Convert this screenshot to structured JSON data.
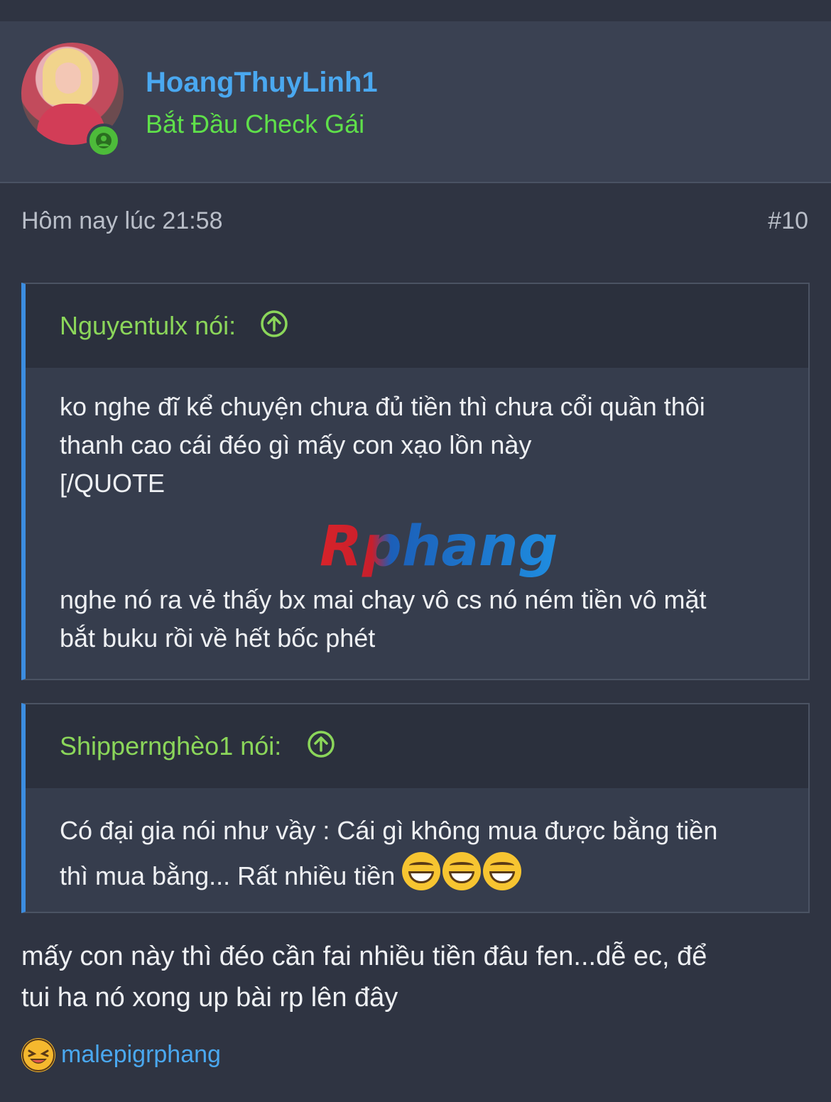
{
  "user": {
    "username": "HoangThuyLinh1",
    "title": "Bắt Đầu Check Gái",
    "avatar_icon": "user-avatar",
    "status_icon": "online-user-icon",
    "status_color": "#4dbb3a"
  },
  "post": {
    "time": "Hôm nay lúc 21:58",
    "number": "#10"
  },
  "quotes": [
    {
      "author": "Nguyentulx nói:",
      "icon": "arrow-up-circle-icon",
      "lines": [
        "ko nghe đĩ kể chuyện chưa đủ tiền thì chưa cổi quần thôi",
        "thanh cao cái đéo gì mấy con xạo lồn này",
        "[/QUOTE"
      ],
      "watermark": "Rphang",
      "lines_after": [
        "nghe nó ra vẻ thấy bx mai chay vô cs nó ném tiền vô mặt",
        "bắt buku rồi về hết bốc phét"
      ]
    },
    {
      "author": "Shippernghèo1 nói:",
      "icon": "arrow-up-circle-icon",
      "lines": [
        "Có đại gia nói như vầy : Cái gì không mua được bằng tiền",
        "thì mua bằng... Rất nhiều tiền"
      ],
      "emoji_icon": "grinning-face-emoji"
    }
  ],
  "reply": {
    "line1": "mấy con này thì đéo cần fai nhiều tiền đâu fen...dễ ec, để",
    "line2": "tui ha nó xong up bài rp lên đây"
  },
  "reactions": {
    "icon": "laughing-reaction-icon",
    "users": "malepigrphang"
  },
  "colors": {
    "background": "#2f3442",
    "username": "#4aa8f0",
    "title": "#5fe04a",
    "quote_author": "#8bd65a",
    "quote_border": "#3c8de0"
  }
}
